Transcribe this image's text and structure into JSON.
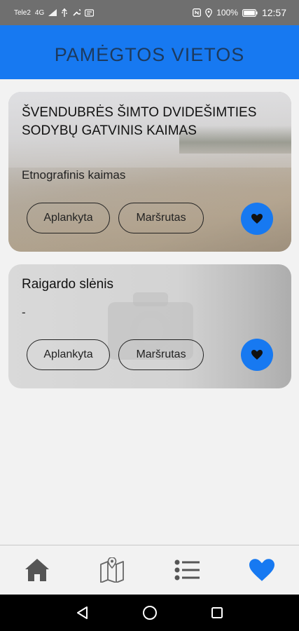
{
  "status": {
    "carrier": "Tele2",
    "network": "4G",
    "battery": "100%",
    "time": "12:57"
  },
  "header": {
    "title": "PAMĖGTOS VIETOS"
  },
  "places": [
    {
      "title": "ŠVENDUBRĖS ŠIMTO DVIDEŠIMTIES SODYBŲ GATVINIS KAIMAS",
      "subtitle": "Etnografinis kaimas",
      "visited_label": "Aplankyta",
      "route_label": "Maršrutas",
      "favorite_icon": "heart-icon"
    },
    {
      "title": "Raigardo slėnis",
      "subtitle": "-",
      "visited_label": "Aplankyta",
      "route_label": "Maršrutas",
      "favorite_icon": "heart-icon"
    }
  ],
  "bottom_nav": {
    "items": [
      {
        "icon": "home-icon",
        "active": false
      },
      {
        "icon": "map-icon",
        "active": false
      },
      {
        "icon": "list-icon",
        "active": false
      },
      {
        "icon": "heart-icon",
        "active": true
      }
    ],
    "active_color": "#1779f1",
    "inactive_color": "#4a4a4a"
  },
  "colors": {
    "accent": "#1779f1",
    "title_text": "#1d3a5e"
  }
}
